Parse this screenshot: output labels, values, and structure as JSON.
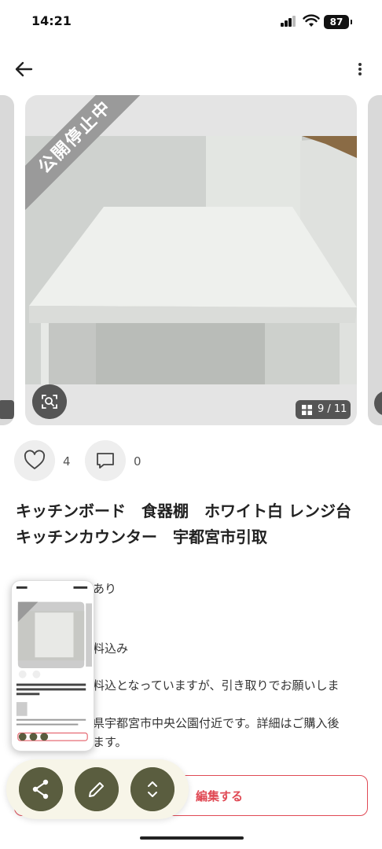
{
  "status_bar": {
    "time": "14:21",
    "battery": "87"
  },
  "listing": {
    "status_ribbon": "公開停止中",
    "image_counter": "9 / 11",
    "likes": "4",
    "comments": "0",
    "title": "キッチンボード　食器棚　ホワイト白 レンジ台 キッチンカウンター　宇都宮市引取",
    "details": {
      "condition_fragment": "あり",
      "shipping_fragment": "料込み",
      "description_line1": "料込となっていますが、引き取りでお願いしま",
      "description_line2": "県宇都宮市中央公園付近です。詳細はご購入後",
      "description_line3": "ます。"
    }
  },
  "bottom": {
    "edit_button_fragment": "編集する"
  },
  "icons": {
    "back": "arrow-left-icon",
    "more": "more-vertical-icon",
    "zoom": "zoom-scan-icon",
    "grid": "grid-icon",
    "like": "heart-icon",
    "comment": "comment-icon",
    "share": "share-icon",
    "edit": "pencil-icon",
    "expand": "expand-icon"
  },
  "colors": {
    "accent_red": "#e04a55",
    "fab_olive": "#5a5d3f",
    "fab_bar_bg": "#f7f5e8",
    "ribbon_gray": "#9a9a9a"
  }
}
